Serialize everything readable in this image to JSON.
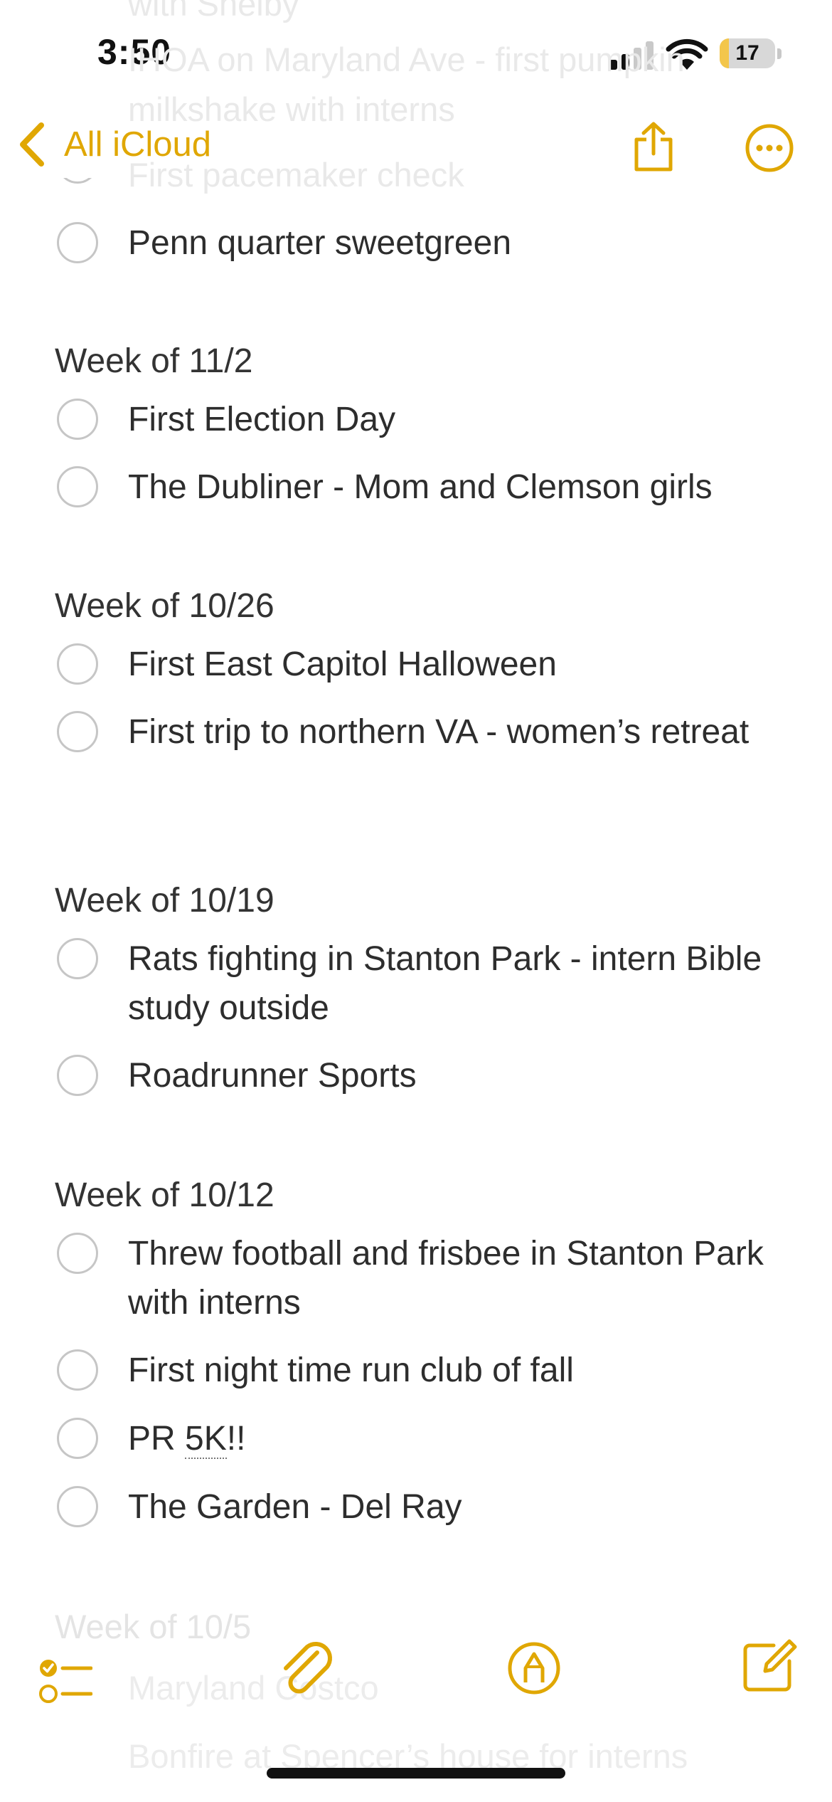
{
  "status": {
    "time": "3:50",
    "battery": "17",
    "battery_level": 0.17
  },
  "nav": {
    "back_label": "All iCloud"
  },
  "ghost_lines": [
    "with Shelby",
    "IHOA on Maryland Ave - first pumpkin",
    "milkshake with interns",
    "First pacemaker check"
  ],
  "top_item": "Penn quarter sweetgreen",
  "weeks": [
    {
      "title": "Week of 11/2",
      "items": [
        "First Election Day",
        "The Dubliner - Mom and Clemson girls"
      ]
    },
    {
      "title": "Week of 10/26",
      "items": [
        "First East Capitol Halloween",
        "First trip to northern VA - women’s retreat"
      ]
    },
    {
      "title": "Week of 10/19",
      "items": [
        "Rats fighting in Stanton Park - intern Bible study outside",
        "Roadrunner Sports"
      ]
    },
    {
      "title": "Week of 10/12",
      "items": [
        "Threw football and frisbee in Stanton Park with interns",
        "First night time run club of fall",
        "PR 5K!!",
        "The Garden - Del Ray"
      ]
    }
  ],
  "bottom_ghost": {
    "week": "Week of 10/5",
    "item1": "Maryland Costco",
    "item2": "Bonfire at Spencer’s house for interns"
  },
  "icons": {
    "back": "chevron-left-icon",
    "share": "share-icon",
    "more": "more-icon",
    "checklist": "checklist-icon",
    "attach": "paperclip-icon",
    "markup": "markup-icon",
    "compose": "compose-icon"
  },
  "colors": {
    "accent": "#e0a703",
    "text": "#2d2d2d",
    "circle": "#c6c6c6"
  }
}
